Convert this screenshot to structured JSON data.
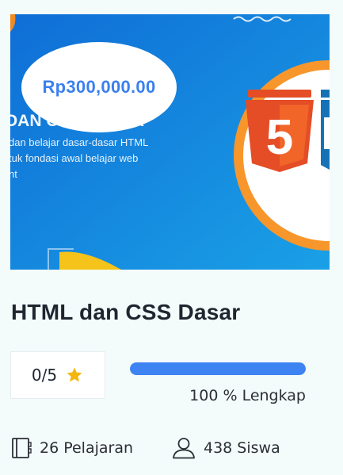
{
  "course": {
    "price": "Rp300,000.00",
    "title": "HTML dan CSS Dasar",
    "thumbnail": {
      "heading": "DAN CSS DASAR",
      "desc_line1": "dan belajar dasar-dasar HTML",
      "desc_line2": "tuk fondasi awal belajar web",
      "desc_line3": "nt",
      "html5_label": "5"
    },
    "rating": "0/5",
    "progress": {
      "percent": 100,
      "label": "100 % Lengkap"
    },
    "lessons": "26 Pelajaran",
    "students": "438 Siswa"
  },
  "colors": {
    "accent_blue": "#3e83f2",
    "price_blue": "#3b7ff0",
    "star": "#f5b70f",
    "thumbnail_bg": "#1273d6",
    "html5_orange": "#e44d26"
  },
  "icons": {
    "star": "star-icon",
    "lessons": "book-icon",
    "students": "user-icon"
  }
}
